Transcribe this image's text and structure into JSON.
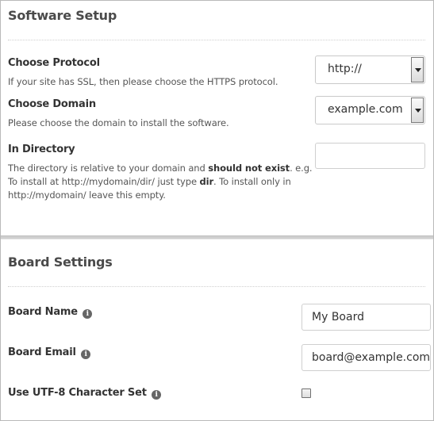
{
  "software_setup": {
    "title": "Software Setup",
    "protocol": {
      "label": "Choose Protocol",
      "help": "If your site has SSL, then please choose the HTTPS protocol.",
      "selected": "http://"
    },
    "domain": {
      "label": "Choose Domain",
      "help": "Please choose the domain to install the software.",
      "selected": "example.com"
    },
    "directory": {
      "label": "In Directory",
      "help_part1": "The directory is relative to your domain and ",
      "help_bold1": "should not exist",
      "help_part2": ". e.g. To install at http://mydomain/dir/ just type ",
      "help_bold2": "dir",
      "help_part3": ". To install only in http://mydomain/ leave this empty.",
      "value": ""
    }
  },
  "board_settings": {
    "title": "Board Settings",
    "board_name": {
      "label": "Board Name",
      "value": "My Board"
    },
    "board_email": {
      "label": "Board Email",
      "value": "board@example.com"
    },
    "utf8": {
      "label": "Use UTF-8 Character Set",
      "checked": false
    }
  },
  "icons": {
    "info": "i"
  }
}
